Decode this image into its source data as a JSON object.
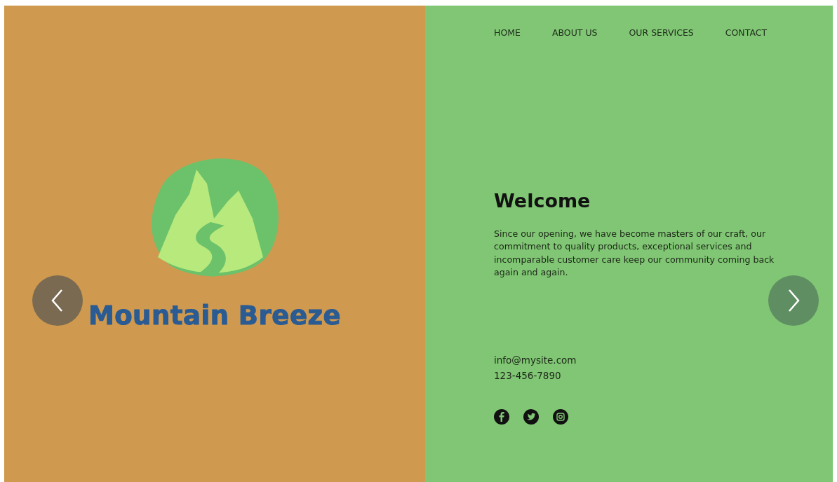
{
  "nav": [
    {
      "label": "HOME"
    },
    {
      "label": "ABOUT US"
    },
    {
      "label": "OUR SERVICES"
    },
    {
      "label": "CONTACT"
    }
  ],
  "brand": {
    "name": "Mountain Breeze"
  },
  "welcome": {
    "title": "Welcome",
    "body": "Since our opening, we have become masters of our craft, our commitment to quality products, exceptional services and incomparable customer care keep our community coming back again and again."
  },
  "contact": {
    "email": "info@mysite.com",
    "phone": "123-456-7890"
  },
  "social": [
    {
      "kind": "facebook"
    },
    {
      "kind": "twitter"
    },
    {
      "kind": "instagram"
    }
  ]
}
